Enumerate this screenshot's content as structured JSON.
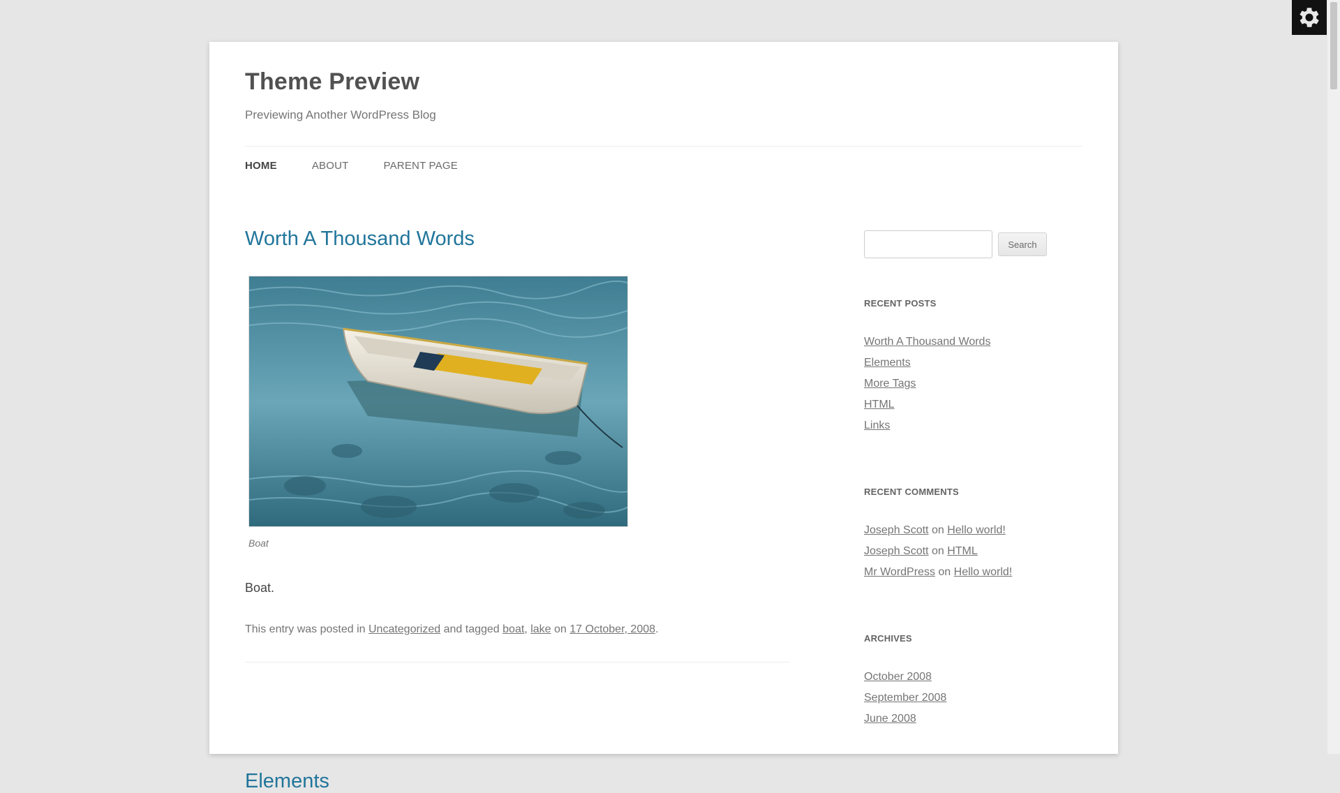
{
  "site": {
    "title": "Theme Preview",
    "description": "Previewing Another WordPress Blog"
  },
  "nav": [
    {
      "label": "Home"
    },
    {
      "label": "About"
    },
    {
      "label": "Parent Page"
    }
  ],
  "post": {
    "title": "Worth A Thousand Words",
    "image_alt": "Boat",
    "caption": "Boat",
    "content": "Boat.",
    "meta": {
      "prefix": "This entry was posted in",
      "category": "Uncategorized",
      "tagged_text": "and tagged",
      "tags": [
        "boat",
        "lake"
      ],
      "on_text": "on",
      "date": "17 October, 2008",
      "suffix": "."
    }
  },
  "next_post": {
    "title": "Elements"
  },
  "sidebar": {
    "search": {
      "placeholder": "",
      "button_label": "Search"
    },
    "recent_posts": {
      "title": "Recent Posts",
      "items": [
        "Worth A Thousand Words",
        "Elements",
        "More Tags",
        "HTML",
        "Links"
      ]
    },
    "recent_comments": {
      "title": "Recent Comments",
      "items": [
        {
          "author": "Joseph Scott",
          "on": "on",
          "post": "Hello world!"
        },
        {
          "author": "Joseph Scott",
          "on": "on",
          "post": "HTML"
        },
        {
          "author": "Mr WordPress",
          "on": "on",
          "post": "Hello world!"
        }
      ]
    },
    "archives": {
      "title": "Archives",
      "items": [
        "October 2008",
        "September 2008",
        "June 2008"
      ]
    }
  },
  "colors": {
    "background": "#e6e6e6",
    "link_accent": "#21759b",
    "text": "#444444"
  },
  "icons": {
    "settings": "gear-icon"
  }
}
